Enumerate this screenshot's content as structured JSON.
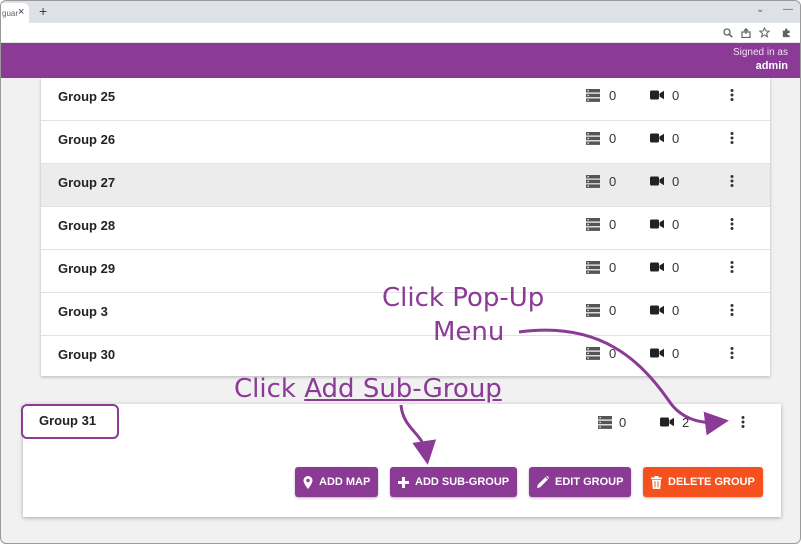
{
  "browser": {
    "tab_title": "guar",
    "tab_close": "×",
    "new_tab": "+",
    "win_chevron": "⌄",
    "win_minimize": "—"
  },
  "header": {
    "signed_in_label": "Signed in as",
    "username": "admin",
    "background": "#8b3a96"
  },
  "groups": [
    {
      "name": "Group 25",
      "servers": "0",
      "cameras": "0",
      "highlighted": false
    },
    {
      "name": "Group 26",
      "servers": "0",
      "cameras": "0",
      "highlighted": false
    },
    {
      "name": "Group 27",
      "servers": "0",
      "cameras": "0",
      "highlighted": true
    },
    {
      "name": "Group 28",
      "servers": "0",
      "cameras": "0",
      "highlighted": false
    },
    {
      "name": "Group 29",
      "servers": "0",
      "cameras": "0",
      "highlighted": false
    },
    {
      "name": "Group 3",
      "servers": "0",
      "cameras": "0",
      "highlighted": false
    },
    {
      "name": "Group 30",
      "servers": "0",
      "cameras": "0",
      "highlighted": false
    }
  ],
  "expanded_group": {
    "name": "Group 31",
    "servers": "0",
    "cameras": "2",
    "buttons": {
      "add_map": "ADD MAP",
      "add_sub_group": "ADD SUB-GROUP",
      "edit_group": "EDIT GROUP",
      "delete_group": "DELETE GROUP"
    }
  },
  "annotations": {
    "popup_line1": "Click Pop-Up",
    "popup_line2": "Menu",
    "subgroup_prefix": "Click ",
    "subgroup_link": "Add Sub-Group"
  },
  "colors": {
    "brand_purple": "#8b3a96",
    "delete_orange": "#f4511e",
    "row_highlight": "#ececec"
  }
}
